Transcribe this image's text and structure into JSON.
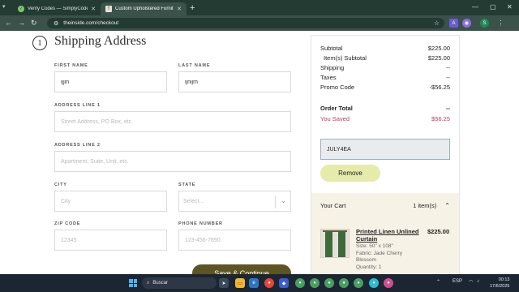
{
  "browser": {
    "tabs": [
      {
        "title": "Verify Codes — SimplyCodes",
        "active": false
      },
      {
        "title": "Custom Upholstered Furniture in",
        "active": true
      }
    ],
    "url": "theinside.com/checkout"
  },
  "shipping": {
    "step_number": "1",
    "title": "Shipping Address",
    "first_name": {
      "label": "FIRST NAME",
      "value": "ijjin"
    },
    "last_name": {
      "label": "LAST NAME",
      "value": "ijnijm"
    },
    "address1": {
      "label": "ADDRESS LINE 1",
      "placeholder": "Street Address, PO Box, etc."
    },
    "address2": {
      "label": "ADDRESS LINE 2",
      "placeholder": "Apartment, Suite, Unit, etc."
    },
    "city": {
      "label": "CITY",
      "placeholder": "City"
    },
    "state": {
      "label": "STATE",
      "placeholder": "Select..."
    },
    "zip": {
      "label": "ZIP CODE",
      "placeholder": "12345"
    },
    "phone": {
      "label": "PHONE NUMBER",
      "placeholder": "123-456-7890"
    },
    "save_label": "Save & Continue"
  },
  "summary": {
    "subtotal": {
      "label": "Subtotal",
      "value": "$225.00"
    },
    "items_subtotal": {
      "label": "Item(s) Subtotal",
      "value": "$225.00"
    },
    "shipping": {
      "label": "Shipping",
      "value": "--"
    },
    "taxes": {
      "label": "Taxes",
      "value": "--"
    },
    "promo": {
      "label": "Promo Code",
      "value": "-$56.25"
    },
    "order_total": {
      "label": "Order Total",
      "value": "--"
    },
    "saved": {
      "label": "You Saved",
      "value": "$56.25"
    },
    "coupon_code": "JULY4EA",
    "remove_label": "Remove",
    "cart": {
      "title": "Your Cart",
      "count": "1 item(s)",
      "item": {
        "name": "Printed Linen Unlined Curtain",
        "price": "$225.00",
        "size": "Size: 50\" x 108\"",
        "fabric": "Fabric: Jade Cherry Blossom",
        "quantity": "Quantity: 1"
      }
    }
  },
  "taskbar": {
    "search_placeholder": "Buscar",
    "language": "ESP",
    "time": "00:13",
    "date": "17/6/2025"
  }
}
